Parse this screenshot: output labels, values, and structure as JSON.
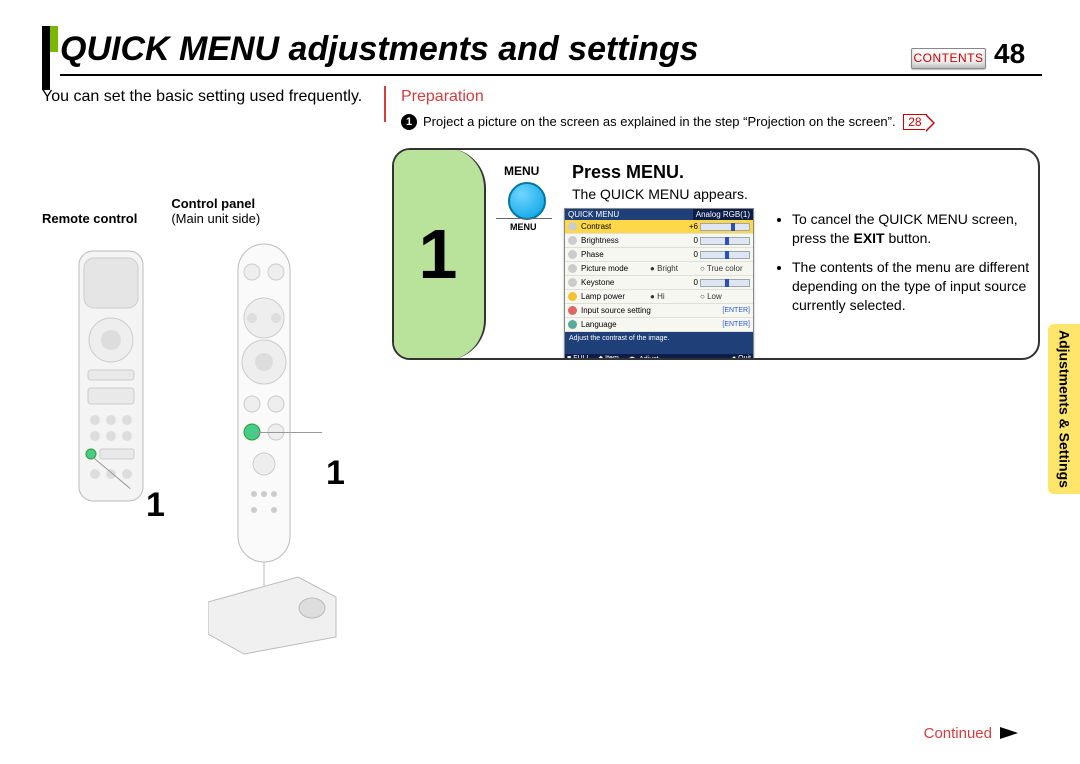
{
  "page": {
    "title": "QUICK MENU adjustments and settings",
    "number": "48",
    "contents_label": "CONTENTS",
    "side_tab": "Adjustments & Settings",
    "continued": "Continued"
  },
  "intro": "You can set the basic setting used frequently.",
  "preparation": {
    "heading": "Preparation",
    "bullet_num": "1",
    "text": "Project a picture on the screen as explained in the step “Projection on the screen”.",
    "page_ref": "28"
  },
  "labels": {
    "remote": "Remote control",
    "control_panel": "Control panel",
    "control_panel_sub": "(Main unit side)"
  },
  "step": {
    "num": "1",
    "menu_label": "MENU",
    "menu_sub": "MENU",
    "heading": "Press MENU.",
    "sub": "The QUICK MENU appears.",
    "notes": [
      "To cancel the QUICK MENU screen, press the EXIT button.",
      "The contents of the menu are different depending on the type of input source currently selected."
    ],
    "callout_1a": "1",
    "callout_1b": "1"
  },
  "quick_menu": {
    "title": "QUICK MENU",
    "source": "Analog RGB(1)",
    "rows": [
      {
        "name": "Contrast",
        "value": "+6",
        "type": "slider",
        "selected": true
      },
      {
        "name": "Brightness",
        "value": "0",
        "type": "slider"
      },
      {
        "name": "Phase",
        "value": "0",
        "type": "slider"
      },
      {
        "name": "Picture mode",
        "value": "",
        "type": "radio",
        "opt1": "Bright",
        "opt2": "True color"
      },
      {
        "name": "Keystone",
        "value": "0",
        "type": "slider"
      },
      {
        "name": "Lamp power",
        "value": "",
        "type": "radio",
        "opt1": "Hi",
        "opt2": "Low"
      },
      {
        "name": "Input source setting",
        "value": "",
        "type": "enter",
        "enter": "[ENTER]"
      },
      {
        "name": "Language",
        "value": "",
        "type": "enter",
        "enter": "[ENTER]"
      }
    ],
    "caption": "Adjust the contrast of the image.",
    "footer": {
      "a": "FULL",
      "b": "Item",
      "c": "Adjust",
      "d": "Quit"
    }
  }
}
